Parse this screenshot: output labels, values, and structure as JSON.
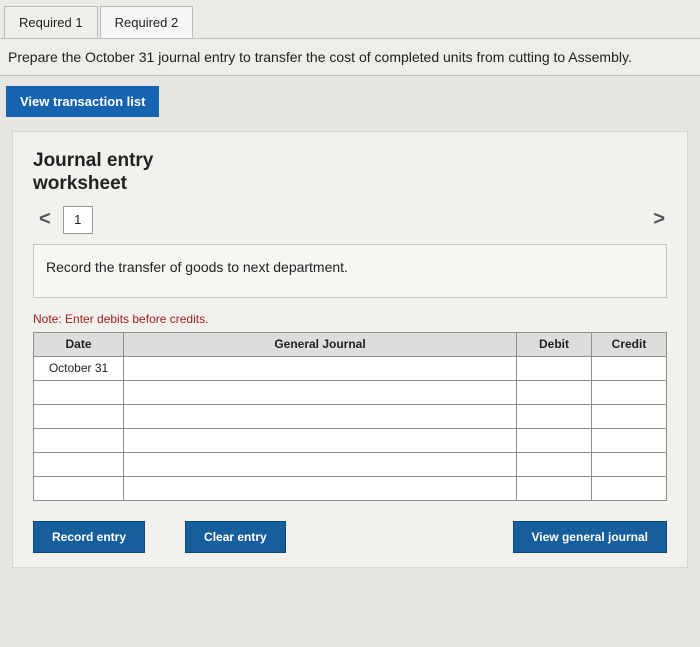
{
  "tabs": {
    "req1": "Required 1",
    "req2": "Required 2"
  },
  "instruction": "Prepare the October 31 journal entry to transfer the cost of completed units from cutting to Assembly.",
  "view_transaction": "View transaction list",
  "worksheet": {
    "title_line1": "Journal entry",
    "title_line2": "worksheet",
    "nav_prev": "<",
    "nav_next": ">",
    "page": "1",
    "description": "Record the transfer of goods to next department.",
    "note": "Note: Enter debits before credits."
  },
  "table": {
    "headers": {
      "date": "Date",
      "gj": "General Journal",
      "debit": "Debit",
      "credit": "Credit"
    },
    "rows": [
      {
        "date": "October 31",
        "gj": "",
        "debit": "",
        "credit": ""
      },
      {
        "date": "",
        "gj": "",
        "debit": "",
        "credit": ""
      },
      {
        "date": "",
        "gj": "",
        "debit": "",
        "credit": ""
      },
      {
        "date": "",
        "gj": "",
        "debit": "",
        "credit": ""
      },
      {
        "date": "",
        "gj": "",
        "debit": "",
        "credit": ""
      },
      {
        "date": "",
        "gj": "",
        "debit": "",
        "credit": ""
      }
    ]
  },
  "buttons": {
    "record": "Record entry",
    "clear": "Clear entry",
    "view_gj": "View general journal"
  }
}
